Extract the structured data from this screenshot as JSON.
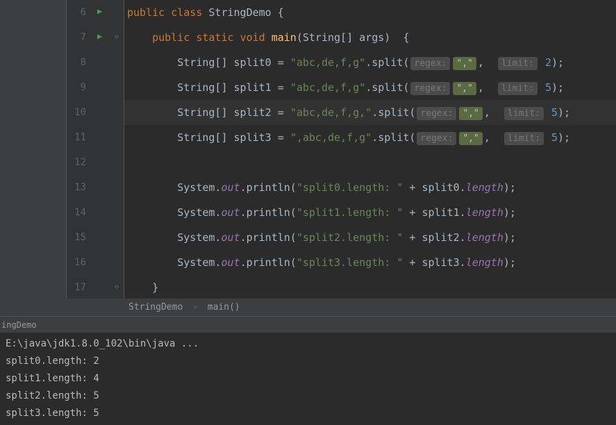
{
  "gutter": {
    "lines": [
      "6",
      "7",
      "8",
      "9",
      "10",
      "11",
      "12",
      "13",
      "14",
      "15",
      "16",
      "17"
    ]
  },
  "code": {
    "l6": {
      "kw1": "public",
      "kw2": "class",
      "cls": "StringDemo",
      "brace": "{"
    },
    "l7": {
      "kw1": "public",
      "kw2": "static",
      "kw3": "void",
      "name": "main",
      "params": "(String[] args)",
      "brace": "{"
    },
    "l8": {
      "decl": "String[] split0 = ",
      "str": "\"abc,de,f,g\"",
      "call": ".split(",
      "hint1": "regex:",
      "arg1": "\",\"",
      "comma": ", ",
      "hint2": "limit:",
      "arg2": "2",
      "end": ");"
    },
    "l9": {
      "decl": "String[] split1 = ",
      "str": "\"abc,de,f,g\"",
      "call": ".split(",
      "hint1": "regex:",
      "arg1": "\",\"",
      "comma": ", ",
      "hint2": "limit:",
      "arg2": "5",
      "end": ");"
    },
    "l10": {
      "decl": "String[] split2 = ",
      "str": "\"abc,de,f,g,\"",
      "call": ".split(",
      "hint1": "regex:",
      "arg1": "\",\"",
      "comma": ", ",
      "hint2": "limit:",
      "arg2": "5",
      "end": ");"
    },
    "l11": {
      "decl": "String[] split3 = ",
      "str": "\",abc,de,f,g\"",
      "call": ".split(",
      "hint1": "regex:",
      "arg1": "\",\"",
      "comma": ", ",
      "hint2": "limit:",
      "arg2": "5",
      "end": ");"
    },
    "l13": {
      "pre": "System.",
      "fld": "out",
      "post": ".println(",
      "str": "\"split0.length: \"",
      "concat": " + split0.",
      "prop": "length",
      "end": ");"
    },
    "l14": {
      "pre": "System.",
      "fld": "out",
      "post": ".println(",
      "str": "\"split1.length: \"",
      "concat": " + split1.",
      "prop": "length",
      "end": ");"
    },
    "l15": {
      "pre": "System.",
      "fld": "out",
      "post": ".println(",
      "str": "\"split2.length: \"",
      "concat": " + split2.",
      "prop": "length",
      "end": ");"
    },
    "l16": {
      "pre": "System.",
      "fld": "out",
      "post": ".println(",
      "str": "\"split3.length: \"",
      "concat": " + split3.",
      "prop": "length",
      "end": ");"
    },
    "l17": {
      "brace": "}"
    }
  },
  "breadcrumb": {
    "cls": "StringDemo",
    "mth": "main()"
  },
  "runTab": "ingDemo",
  "console": {
    "cmd": "E:\\java\\jdk1.8.0_102\\bin\\java ...",
    "out0": "split0.length: 2",
    "out1": "split1.length: 4",
    "out2": "split2.length: 5",
    "out3": "split3.length: 5"
  }
}
